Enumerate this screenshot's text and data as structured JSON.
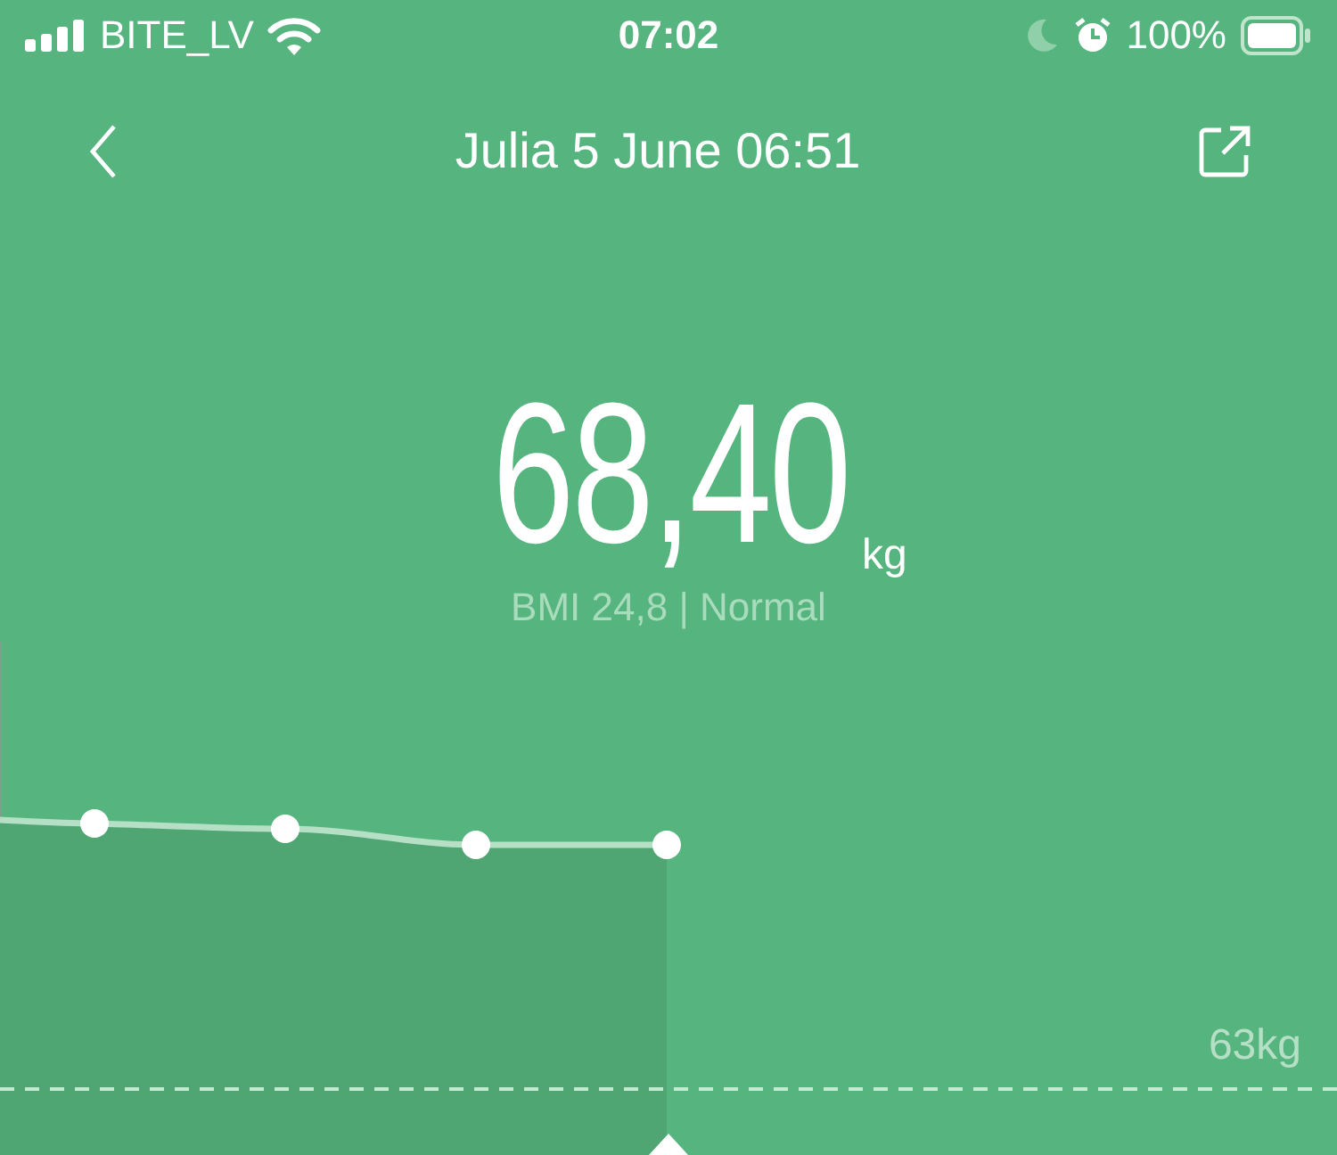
{
  "status_bar": {
    "carrier": "BITE_LV",
    "time": "07:02",
    "battery": "100%"
  },
  "nav": {
    "title": "Julia 5 June 06:51"
  },
  "reading": {
    "weight": "68,40",
    "unit": "kg",
    "bmi": "BMI 24,8 | Normal"
  },
  "chart": {
    "reference_label": "63kg"
  }
}
